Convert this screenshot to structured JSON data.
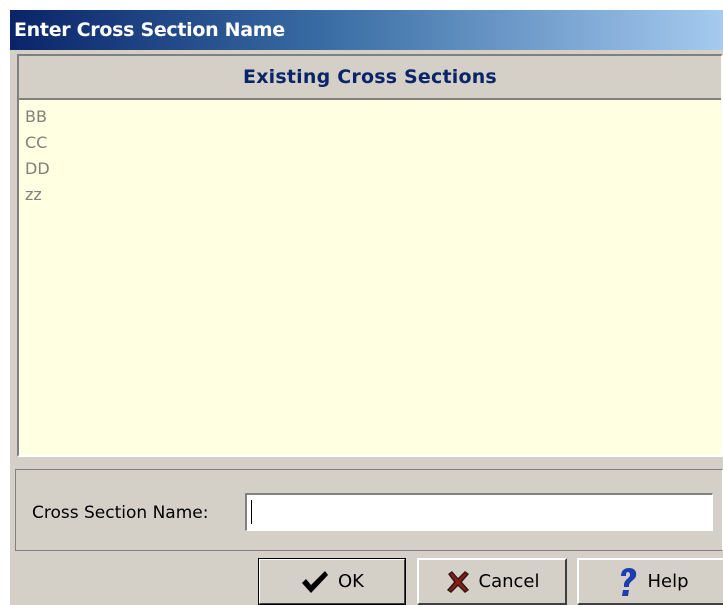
{
  "window": {
    "title": "Enter Cross Section Name"
  },
  "existing_list": {
    "header": "Existing Cross Sections",
    "items": [
      "BB",
      "CC",
      "DD",
      "zz"
    ]
  },
  "name_field": {
    "label": "Cross Section Name:",
    "value": ""
  },
  "buttons": {
    "ok": "OK",
    "cancel": "Cancel",
    "help": "Help"
  },
  "icons": {
    "ok": "checkmark-icon",
    "cancel": "x-icon",
    "help": "question-mark-icon"
  },
  "colors": {
    "title_start": "#0a246a",
    "title_end": "#a6caf0",
    "header_text": "#0a246a",
    "list_background": "#ffffe1",
    "list_text": "#808080",
    "cancel_icon": "#8b1a1a",
    "help_icon": "#1a3fb0"
  }
}
